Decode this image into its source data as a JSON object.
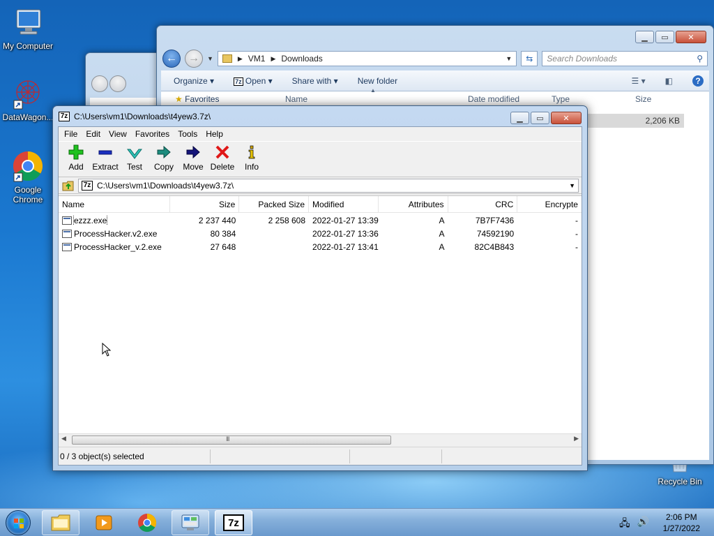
{
  "desktop": {
    "icons": [
      {
        "label": "My Computer"
      },
      {
        "label": "DataWagon..."
      },
      {
        "label": "Google Chrome"
      },
      {
        "label": "Recycle Bin"
      }
    ]
  },
  "explorer": {
    "breadcrumb": [
      "VM1",
      "Downloads"
    ],
    "search_placeholder": "Search Downloads",
    "commands": [
      "Organize",
      "Open",
      "Share with",
      "New folder"
    ],
    "nav_favorites": "Favorites",
    "columns": [
      "Name",
      "Date modified",
      "Type",
      "Size"
    ],
    "visible_size": "2,206 KB"
  },
  "sevenzip": {
    "title": "C:\\Users\\vm1\\Downloads\\t4yew3.7z\\",
    "logo": "7z",
    "menu": [
      "File",
      "Edit",
      "View",
      "Favorites",
      "Tools",
      "Help"
    ],
    "toolbar": [
      {
        "label": "Add",
        "icon": "plus-icon"
      },
      {
        "label": "Extract",
        "icon": "minus-icon"
      },
      {
        "label": "Test",
        "icon": "check-icon"
      },
      {
        "label": "Copy",
        "icon": "copy-arrow-icon"
      },
      {
        "label": "Move",
        "icon": "move-arrow-icon"
      },
      {
        "label": "Delete",
        "icon": "delete-x-icon"
      },
      {
        "label": "Info",
        "icon": "info-icon"
      }
    ],
    "path": "C:\\Users\\vm1\\Downloads\\t4yew3.7z\\",
    "columns": {
      "name": "Name",
      "size": "Size",
      "packed": "Packed Size",
      "modified": "Modified",
      "attributes": "Attributes",
      "crc": "CRC",
      "encrypted": "Encrypte"
    },
    "files": [
      {
        "name": "ezzz.exe",
        "size": "2 237 440",
        "packed": "2 258 608",
        "modified": "2022-01-27 13:39",
        "attributes": "A",
        "crc": "7B7F7436",
        "encrypted": "-"
      },
      {
        "name": "ProcessHacker.v2.exe",
        "size": "80 384",
        "packed": "",
        "modified": "2022-01-27 13:36",
        "attributes": "A",
        "crc": "74592190",
        "encrypted": "-"
      },
      {
        "name": "ProcessHacker_v.2.exe",
        "size": "27 648",
        "packed": "",
        "modified": "2022-01-27 13:41",
        "attributes": "A",
        "crc": "82C4B843",
        "encrypted": "-"
      }
    ],
    "status": "0 / 3 object(s) selected",
    "scroll_marker": "III"
  },
  "taskbar": {
    "time": "2:06 PM",
    "date": "1/27/2022",
    "apps": [
      "explorer-icon",
      "media-player-icon",
      "chrome-icon",
      "control-panel-icon",
      "sevenzip-icon"
    ]
  }
}
